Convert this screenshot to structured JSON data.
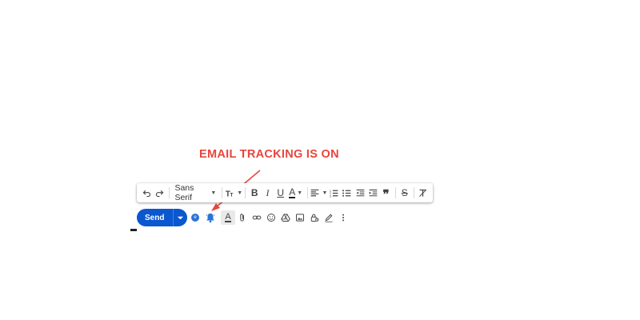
{
  "annotation": {
    "text": "EMAIL TRACKING IS ON",
    "color": "#e8453c"
  },
  "format_toolbar": {
    "font_name": "Sans Serif",
    "items": [
      "undo-icon",
      "redo-icon",
      "font-select",
      "text-size-icon",
      "bold-icon",
      "italic-icon",
      "underline-icon",
      "text-color-icon",
      "align-icon",
      "numbered-list-icon",
      "bulleted-list-icon",
      "indent-less-icon",
      "indent-more-icon",
      "quote-icon",
      "strikethrough-icon",
      "remove-formatting-icon"
    ]
  },
  "compose_bar": {
    "send_label": "Send",
    "send_color": "#0b57d0",
    "tracker_badge": "e",
    "items": [
      "tracking-icon",
      "notification-bell-icon",
      "formatting-options-icon",
      "attach-icon",
      "link-icon",
      "emoji-icon",
      "drive-icon",
      "photo-icon",
      "confidential-lock-icon",
      "signature-icon",
      "more-options-icon"
    ]
  }
}
